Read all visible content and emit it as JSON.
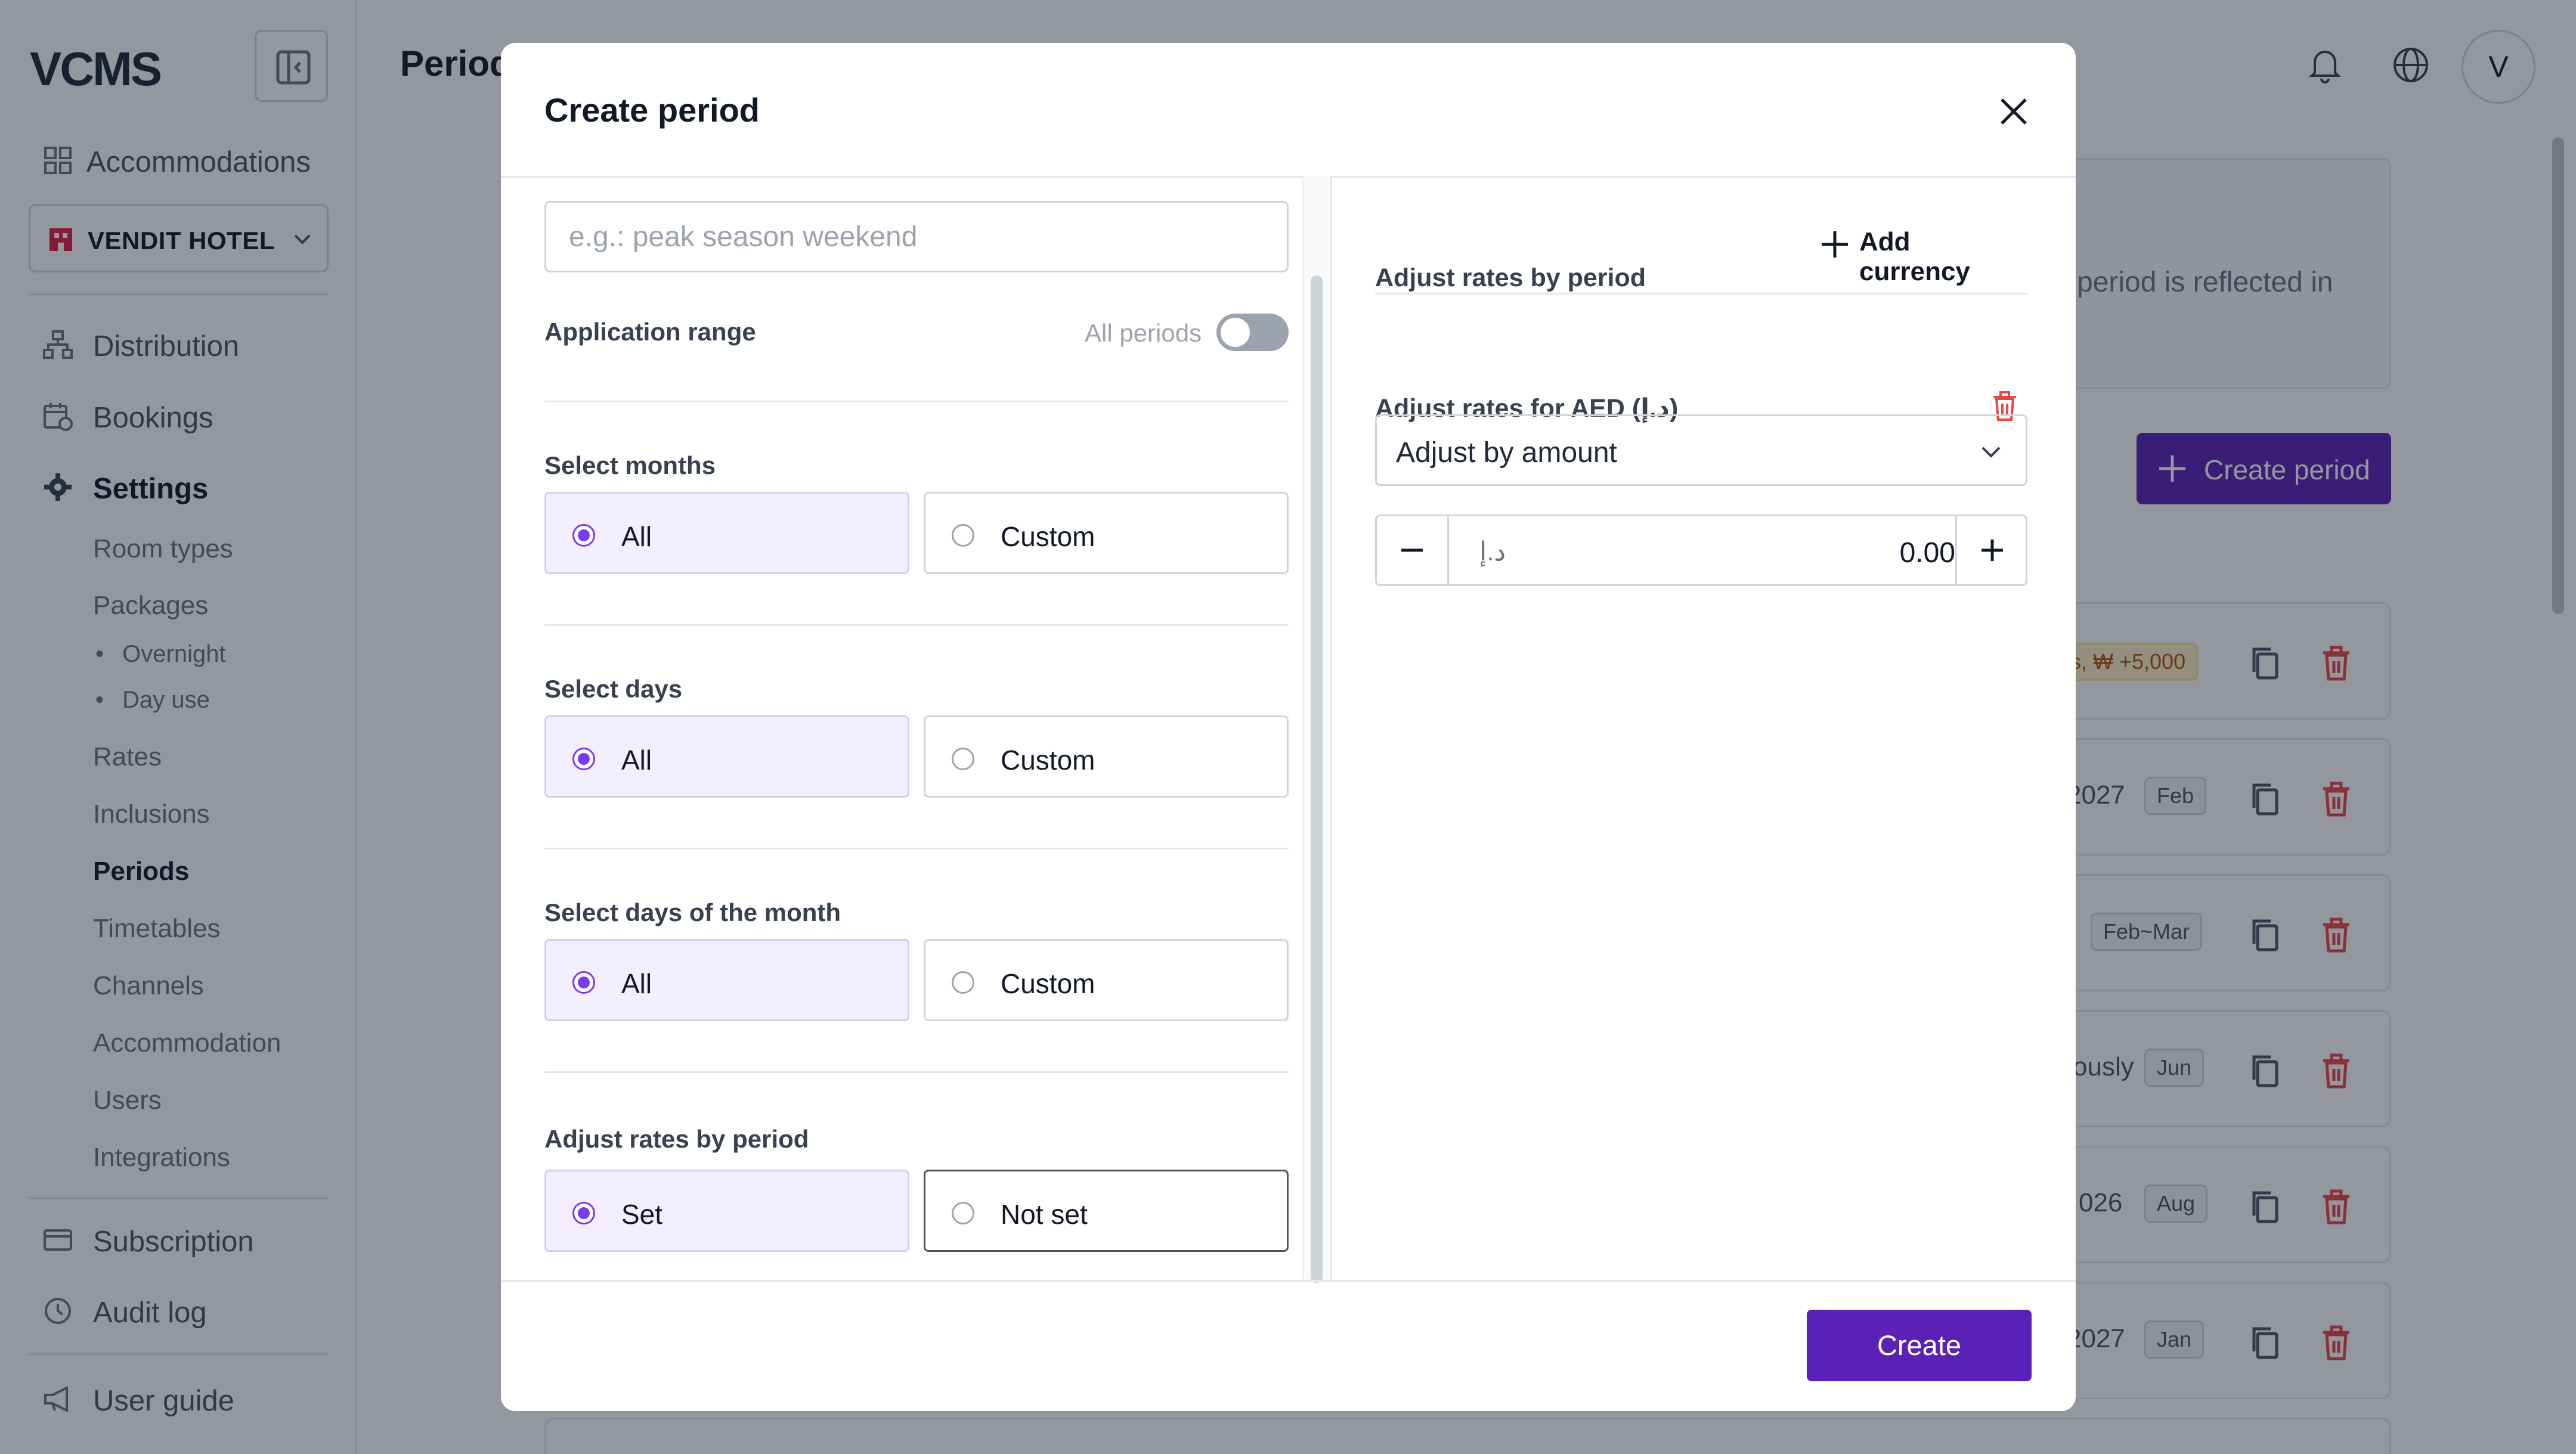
{
  "app": {
    "logo": "VCMS"
  },
  "sidebar": {
    "accommodations": "Accommodations",
    "hotel": "VENDIT HOTEL",
    "distribution": "Distribution",
    "bookings": "Bookings",
    "settings": "Settings",
    "settings_items": [
      "Room types",
      "Packages",
      "Rates",
      "Inclusions",
      "Periods",
      "Timetables",
      "Channels",
      "Accommodation",
      "Users",
      "Integrations"
    ],
    "packages_sub": [
      "Overnight",
      "Day use"
    ],
    "subscription": "Subscription",
    "audit_log": "Audit log",
    "user_guide": "User guide",
    "active_item": "Periods"
  },
  "header": {
    "title": "Period",
    "avatar_letter": "V"
  },
  "main": {
    "notice_text": "period is reflected in",
    "create_period_button": "Create period",
    "rows": [
      {
        "text": "s, ₩ +5,000",
        "chip": "",
        "warn": true
      },
      {
        "text": "2027",
        "chip": "Feb"
      },
      {
        "text": "",
        "chip": "Feb~Mar"
      },
      {
        "text": "ously",
        "chip": "Jun"
      },
      {
        "text": "026",
        "chip": "Aug"
      },
      {
        "text": "2027",
        "chip": "Jan"
      }
    ]
  },
  "modal": {
    "title": "Create period",
    "name_placeholder": "e.g.: peak season weekend",
    "application_range_label": "Application range",
    "all_periods_label": "All periods",
    "all_periods_on": false,
    "select_months": {
      "label": "Select months",
      "options": [
        "All",
        "Custom"
      ],
      "selected": "All"
    },
    "select_days": {
      "label": "Select days",
      "options": [
        "All",
        "Custom"
      ],
      "selected": "All"
    },
    "select_days_of_month": {
      "label": "Select days of the month",
      "options": [
        "All",
        "Custom"
      ],
      "selected": "All"
    },
    "adjust_rates_left": {
      "label": "Adjust rates by period",
      "options": [
        "Set",
        "Not set"
      ],
      "selected": "Set"
    },
    "right_panel": {
      "title": "Adjust rates by period",
      "add_currency": "Add currency",
      "currency_title": "Adjust rates for AED (د.إ)",
      "adjust_select_value": "Adjust by amount",
      "currency_symbol": "د.إ",
      "amount": "0.00"
    },
    "create_button": "Create"
  },
  "colors": {
    "primary": "#5b21b6",
    "radio_accent": "#7c3aed",
    "danger": "#ef4444",
    "selected_bg": "#f3efff"
  }
}
